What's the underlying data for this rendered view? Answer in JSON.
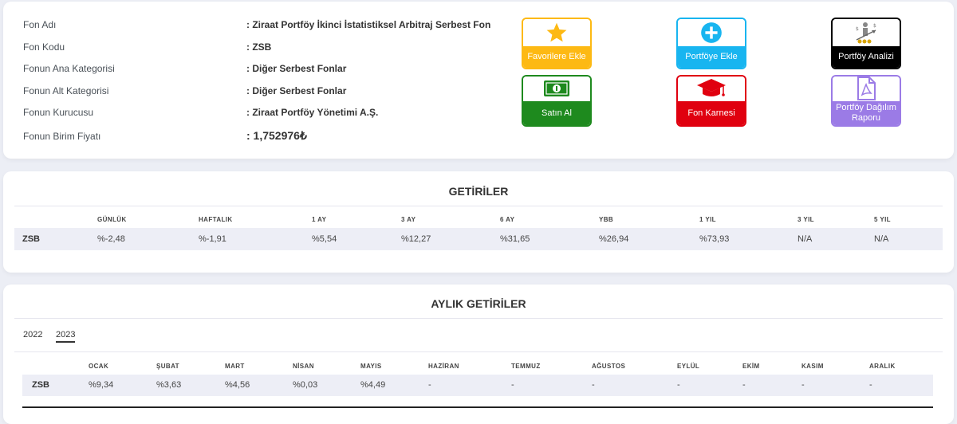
{
  "fund_info": {
    "rows": [
      {
        "label": "Fon Adı",
        "value": ": Ziraat Portföy İkinci İstatistiksel Arbitraj Serbest Fon"
      },
      {
        "label": "Fon Kodu",
        "value": ": ZSB"
      },
      {
        "label": "Fonun Ana Kategorisi",
        "value": ": Diğer Serbest Fonlar"
      },
      {
        "label": "Fonun Alt Kategorisi",
        "value": ": Diğer Serbest Fonlar"
      },
      {
        "label": "Fonun Kurucusu",
        "value": ": Ziraat Portföy Yönetimi A.Ş."
      },
      {
        "label": "Fonun Birim Fiyatı",
        "value": ": 1,752976₺"
      }
    ]
  },
  "actions": {
    "favorites": {
      "label": "Favorilere Ekle",
      "icon": "star-icon",
      "color": "#fdb913"
    },
    "add_portfolio": {
      "label": "Portföye Ekle",
      "icon": "plus-circle-icon",
      "color": "#18b5f0"
    },
    "portfolio_analysis": {
      "label": "Portföy Analizi",
      "icon": "analysis-icon",
      "color": "#000000"
    },
    "buy": {
      "label": "Satın Al",
      "icon": "money-icon",
      "color": "#1e8a1e"
    },
    "fund_card": {
      "label": "Fon Karnesi",
      "icon": "graduation-cap-icon",
      "color": "#e0000f"
    },
    "distribution_report": {
      "label": "Portföy Dağılım Raporu",
      "icon": "pdf-icon",
      "color": "#9b7be6"
    }
  },
  "returns": {
    "title": "GETİRİLER",
    "headers": [
      "GÜNLÜK",
      "HAFTALIK",
      "1 AY",
      "3 AY",
      "6 AY",
      "YBB",
      "1 YIL",
      "3 YIL",
      "5 YIL"
    ],
    "row": {
      "code": "ZSB",
      "values": [
        "%-2,48",
        "%-1,91",
        "%5,54",
        "%12,27",
        "%31,65",
        "%26,94",
        "%73,93",
        "N/A",
        "N/A"
      ]
    }
  },
  "monthly": {
    "title": "AYLIK GETİRİLER",
    "years": [
      "2022",
      "2023"
    ],
    "selected_year": "2023",
    "headers": [
      "OCAK",
      "ŞUBAT",
      "MART",
      "NİSAN",
      "MAYIS",
      "HAZİRAN",
      "TEMMUZ",
      "AĞUSTOS",
      "EYLÜL",
      "EKİM",
      "KASIM",
      "ARALIK"
    ],
    "row": {
      "code": "ZSB",
      "values": [
        "%9,34",
        "%3,63",
        "%4,56",
        "%0,03",
        "%4,49",
        "-",
        "-",
        "-",
        "-",
        "-",
        "-",
        "-"
      ]
    }
  }
}
